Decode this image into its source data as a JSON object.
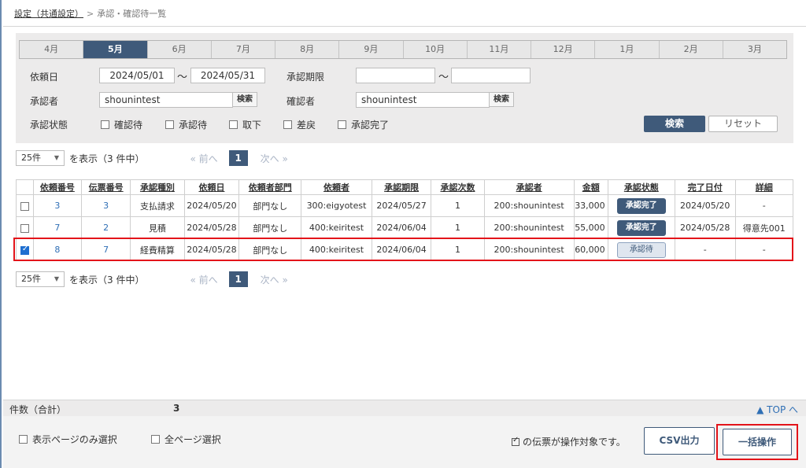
{
  "breadcrumb": {
    "parent": "設定（共通設定）",
    "separator": ">",
    "current": "承認・確認待一覧"
  },
  "months": [
    "4月",
    "5月",
    "6月",
    "7月",
    "8月",
    "9月",
    "10月",
    "11月",
    "12月",
    "1月",
    "2月",
    "3月"
  ],
  "active_month": "5月",
  "filters": {
    "request_date_label": "依頼日",
    "request_date_from": "2024/05/01",
    "request_date_to": "2024/05/31",
    "tilde": "〜",
    "deadline_label": "承認期限",
    "deadline_from": "",
    "deadline_to": "",
    "approver_label": "承認者",
    "approver_value": "shounintest",
    "confirmer_label": "確認者",
    "confirmer_value": "shounintest",
    "lookup_label": "検索",
    "status_label": "承認状態",
    "status_options": [
      "確認待",
      "承認待",
      "取下",
      "差戻",
      "承認完了"
    ],
    "search_button": "検索",
    "reset_button": "リセット"
  },
  "pager": {
    "per_page": "25件",
    "display_text": "を表示（3 件中）",
    "prev": "« 前へ",
    "page": "1",
    "next": "次へ »"
  },
  "table": {
    "headers": [
      "依頼番号",
      "伝票番号",
      "承認種別",
      "依頼日",
      "依頼者部門",
      "依頼者",
      "承認期限",
      "承認次数",
      "承認者",
      "金額",
      "承認状態",
      "完了日付",
      "詳細"
    ],
    "rows": [
      {
        "checked": false,
        "request_no": "3",
        "slip_no": "3",
        "type": "支払請求",
        "date": "2024/05/20",
        "dept": "部門なし",
        "requester": "300:eigyotest",
        "deadline": "2024/05/27",
        "level": "1",
        "approver": "200:shounintest",
        "amount": "33,000",
        "status": "承認完了",
        "completed": "2024/05/20",
        "detail": "-"
      },
      {
        "checked": false,
        "request_no": "7",
        "slip_no": "2",
        "type": "見積",
        "date": "2024/05/28",
        "dept": "部門なし",
        "requester": "400:keiritest",
        "deadline": "2024/06/04",
        "level": "1",
        "approver": "200:shounintest",
        "amount": "55,000",
        "status": "承認完了",
        "completed": "2024/05/28",
        "detail": "得意先001"
      },
      {
        "checked": true,
        "request_no": "8",
        "slip_no": "7",
        "type": "経費精算",
        "date": "2024/05/28",
        "dept": "部門なし",
        "requester": "400:keiritest",
        "deadline": "2024/06/04",
        "level": "1",
        "approver": "200:shounintest",
        "amount": "60,000",
        "status": "承認待",
        "completed": "-",
        "detail": "-"
      }
    ]
  },
  "footer": {
    "count_label": "件数（合計）",
    "count_value": "3",
    "top_link": "▲ TOP へ",
    "select_page_only": "表示ページのみ選択",
    "select_all_pages": "全ページ選択",
    "target_note": "の伝票が操作対象です。",
    "csv_button": "CSV出力",
    "bulk_button": "一括操作"
  },
  "colors": {
    "accent": "#3f5a7a",
    "highlight": "#e3141a",
    "link": "#2f6fb5"
  }
}
